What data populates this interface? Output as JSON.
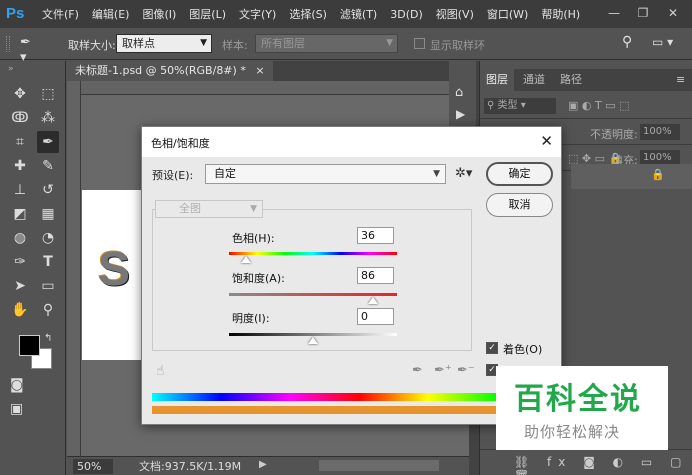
{
  "app": {
    "logo": "Ps"
  },
  "menu": [
    "文件(F)",
    "编辑(E)",
    "图像(I)",
    "图层(L)",
    "文字(Y)",
    "选择(S)",
    "滤镜(T)",
    "3D(D)",
    "视图(V)",
    "窗口(W)",
    "帮助(H)"
  ],
  "window_controls": {
    "minimize": "—",
    "restore": "❐",
    "close": "✕"
  },
  "options_bar": {
    "sample_size_label": "取样大小:",
    "sample_size_value": "取样点",
    "sample_label": "样本:",
    "sample_value": "所有图层",
    "show_ring_label": "显示取样环"
  },
  "document": {
    "tab_title": "未标题-1.psd @ 50%(RGB/8#) *",
    "tab_close": "×",
    "zoom": "50%",
    "doc_info": "文档:937.5K/1.19M",
    "letter": "S"
  },
  "layers_panel": {
    "tabs": [
      "图层",
      "通道",
      "路径"
    ],
    "kind_label": "类型",
    "opacity_label": "不透明度:",
    "opacity_value": "100%",
    "lock_label": "锁定:",
    "fill_label": "填充:",
    "fill_value": "100%"
  },
  "dialog": {
    "title": "色相/饱和度",
    "close": "✕",
    "preset_label": "预设(E):",
    "preset_value": "自定",
    "ok_label": "确定",
    "cancel_label": "取消",
    "channel_value": "全图",
    "hue_label": "色相(H):",
    "hue_value": "36",
    "saturation_label": "饱和度(A):",
    "saturation_value": "86",
    "lightness_label": "明度(I):",
    "lightness_value": "0",
    "colorize_label": "着色(O)",
    "colorize_checked": true,
    "preview_checked": true,
    "hue_fraction": 0.1,
    "saturation_fraction": 0.86,
    "lightness_fraction": 0.5
  },
  "watermark": {
    "title": "百科全说",
    "subtitle": "助你轻松解决",
    "color": "#21a84b"
  }
}
